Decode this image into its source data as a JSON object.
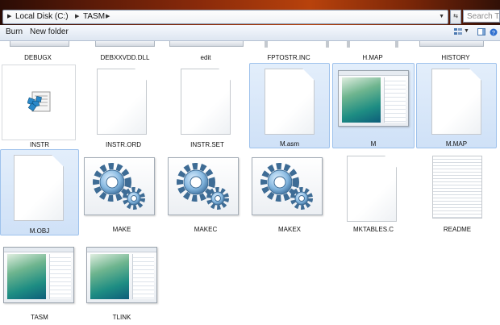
{
  "address_bar": {
    "crumbs": [
      "Local Disk (C:)",
      "TASM"
    ],
    "search_placeholder": "Search TA..."
  },
  "toolbar": {
    "burn_label": "Burn",
    "new_folder_label": "New folder"
  },
  "top_row_labels": [
    "DEBUGX",
    "DEBXXVDD.DLL",
    "edit",
    "FPTOSTR.INC",
    "H.MAP",
    "HISTORY"
  ],
  "files": [
    {
      "name": "INSTR",
      "icon": "dos-batch-icon",
      "selected": false
    },
    {
      "name": "INSTR.ORD",
      "icon": "blank-document-icon",
      "selected": false
    },
    {
      "name": "INSTR.SET",
      "icon": "blank-document-icon",
      "selected": false
    },
    {
      "name": "M.asm",
      "icon": "blank-document-icon",
      "selected": true
    },
    {
      "name": "M",
      "icon": "application-window-icon",
      "selected": true
    },
    {
      "name": "M.MAP",
      "icon": "blank-document-icon",
      "selected": true
    },
    {
      "name": "M.OBJ",
      "icon": "blank-document-icon",
      "selected": true
    },
    {
      "name": "MAKE",
      "icon": "gears-application-icon",
      "selected": false
    },
    {
      "name": "MAKEC",
      "icon": "gears-application-icon",
      "selected": false
    },
    {
      "name": "MAKEX",
      "icon": "gears-application-icon",
      "selected": false
    },
    {
      "name": "MKTABLES.C",
      "icon": "blank-document-icon",
      "selected": false
    },
    {
      "name": "README",
      "icon": "text-document-icon",
      "selected": false
    },
    {
      "name": "TASM",
      "icon": "application-window-icon",
      "selected": false
    },
    {
      "name": "TLINK",
      "icon": "application-window-icon",
      "selected": false
    }
  ],
  "colors": {
    "selection_fill": "#cfe1f7",
    "selection_border": "#9ec2ec"
  }
}
